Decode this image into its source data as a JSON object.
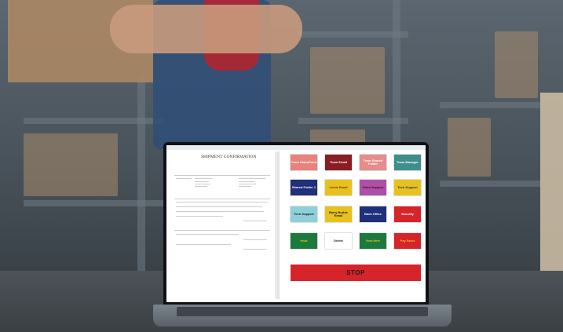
{
  "document": {
    "window_title": "",
    "title": "SHIPMENT CONFIRMATION"
  },
  "buttons": [
    {
      "label": "Team SharePoint",
      "bg": "#e8827b",
      "fg": "#ffffff"
    },
    {
      "label": "Team Email",
      "bg": "#8a1c24",
      "fg": "#ffffff"
    },
    {
      "label": "Team Shared Folder",
      "bg": "#e58c8c",
      "fg": "#ffffff"
    },
    {
      "label": "Team Manager",
      "bg": "#3c8f8a",
      "fg": "#ffffff"
    },
    {
      "label": "Shared Folder 1",
      "bg": "#1f2f7a",
      "fg": "#ffffff"
    },
    {
      "label": "Lorrie Email",
      "bg": "#e8c21c",
      "fg": "#8a1c24"
    },
    {
      "label": "Sales Support",
      "bg": "#b04fa8",
      "fg": "#2a1a2a"
    },
    {
      "label": "Tech Support",
      "bg": "#e8c21c",
      "fg": "#1f2f7a"
    },
    {
      "label": "Tech Support",
      "bg": "#8fd0d8",
      "fg": "#1a1a1a"
    },
    {
      "label": "Barry Budde Email",
      "bg": "#e8c21c",
      "fg": "#1a1a1a"
    },
    {
      "label": "Back Office",
      "bg": "#1f2f7a",
      "fg": "#ffffff"
    },
    {
      "label": "Security",
      "bg": "#d6242b",
      "fg": "#ffffff"
    },
    {
      "label": "Hold",
      "bg": "#1c7a3c",
      "fg": "#e8c21c"
    },
    {
      "label": "Delete",
      "bg": "#ffffff",
      "fg": "#1a1a1a"
    },
    {
      "label": "New Item",
      "bg": "#1c7a3c",
      "fg": "#e8c21c"
    },
    {
      "label": "Pay Sales",
      "bg": "#d6242b",
      "fg": "#e8c21c"
    }
  ],
  "stop_button": {
    "label": "STOP",
    "bg": "#d6242b"
  }
}
